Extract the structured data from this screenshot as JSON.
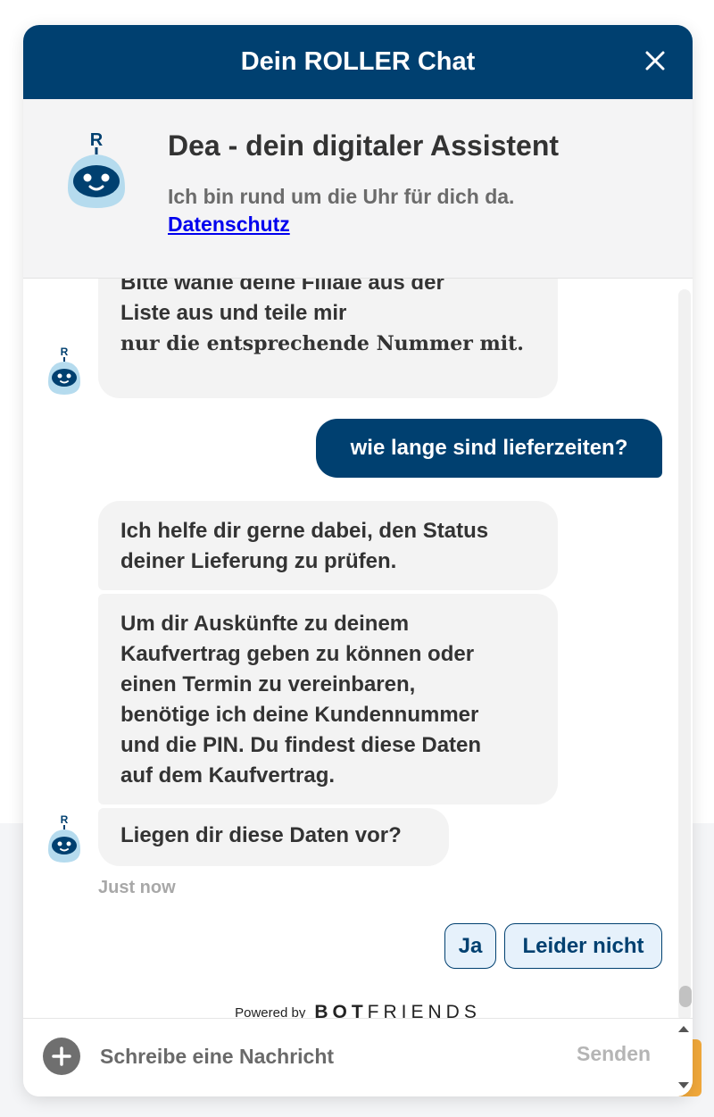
{
  "header": {
    "title": "Dein ROLLER Chat",
    "close_icon": "close-icon",
    "background": "#004070"
  },
  "intro": {
    "name": "Dea - dein digitaler Assistent",
    "subtitle": "Ich bin rund um die Uhr für dich da.",
    "privacy_link": "Datenschutz",
    "avatar_icon": "robot-avatar-icon",
    "avatar_letter": "R"
  },
  "messages": [
    {
      "sender": "bot",
      "lines": [
        "Bitte wähle deine Filiale aus der",
        "Liste aus und teile mir",
        "nur die entsprechende Nummer mit."
      ]
    },
    {
      "sender": "user",
      "text": "wie lange sind lieferzeiten?"
    },
    {
      "sender": "bot",
      "lines": [
        "Ich helfe dir gerne dabei, den Status",
        "deiner Lieferung zu prüfen."
      ]
    },
    {
      "sender": "bot",
      "lines": [
        "Um dir Auskünfte zu deinem",
        "Kaufvertrag geben zu können oder",
        "einen Termin zu vereinbaren,",
        "benötige ich deine Kundennummer",
        "und die PIN. Du findest diese Daten",
        "auf dem Kaufvertrag."
      ]
    },
    {
      "sender": "bot",
      "text": "Liegen dir diese Daten vor?"
    }
  ],
  "timestamp": "Just now",
  "quick_replies": [
    "Ja",
    "Leider nicht"
  ],
  "powered_by": {
    "label": "Powered by",
    "brand_bold": "BOT",
    "brand_light": "FRIENDS"
  },
  "composer": {
    "placeholder": "Schreibe eine Nachricht",
    "value": "",
    "send_label": "Senden",
    "add_icon": "plus-circle-icon"
  },
  "colors": {
    "brand": "#004070",
    "bot_bubble": "#f3f3f3",
    "quick_reply_bg": "#e6f1fb",
    "accent_tab": "#f2a93b"
  }
}
